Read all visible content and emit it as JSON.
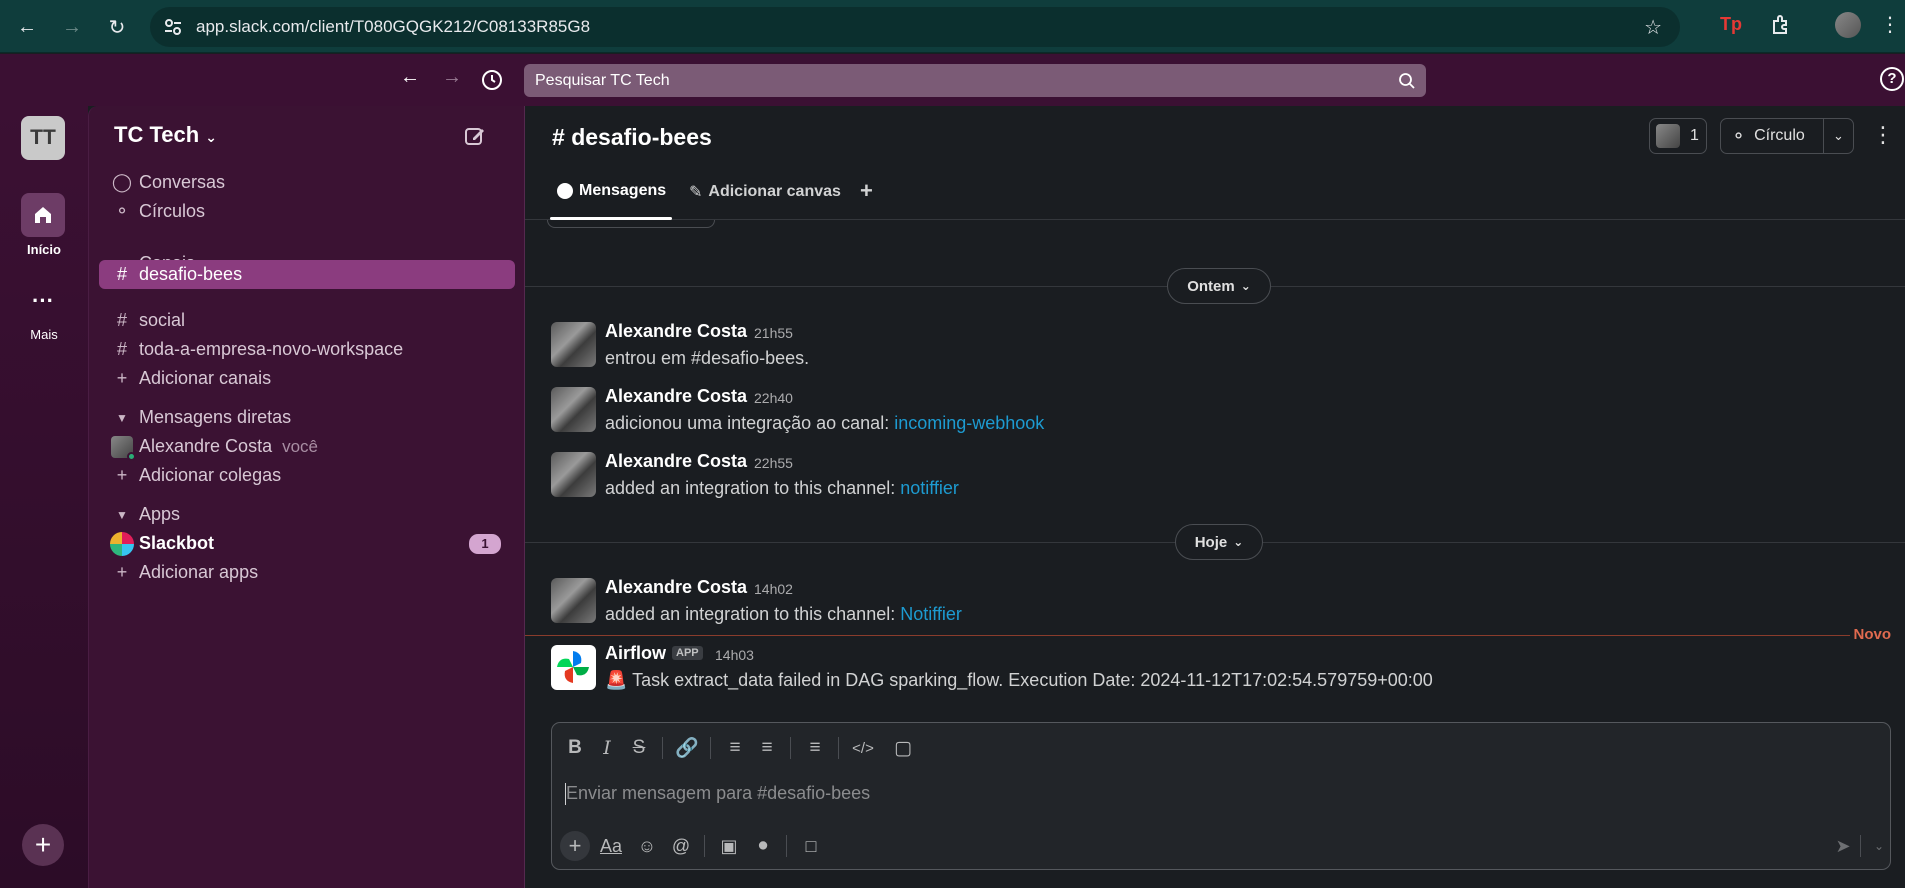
{
  "browser": {
    "url": "app.slack.com/client/T080GQGK212/C08133R85G8"
  },
  "slack_top": {
    "search_placeholder": "Pesquisar TC Tech",
    "help": "?"
  },
  "rail": {
    "workspace_initials": "TT",
    "home_label": "Início",
    "more_label": "Mais"
  },
  "sidebar": {
    "workspace_name": "TC Tech",
    "top_items": [
      {
        "label": "Conversas",
        "icon": "threads-icon"
      },
      {
        "label": "Círculos",
        "icon": "headphones-icon"
      }
    ],
    "channels_header": "Canais",
    "channels": [
      {
        "label": "desafio-bees",
        "active": true
      },
      {
        "label": "social",
        "active": false
      },
      {
        "label": "toda-a-empresa-novo-workspace",
        "active": false
      }
    ],
    "add_channels": "Adicionar canais",
    "dm_header": "Mensagens diretas",
    "dm_user": "Alexandre Costa",
    "dm_you": "você",
    "add_colleagues": "Adicionar colegas",
    "apps_header": "Apps",
    "app_slackbot": "Slackbot",
    "slackbot_badge": "1",
    "add_apps": "Adicionar apps"
  },
  "channel": {
    "title": "desafio-bees",
    "member_count": "1",
    "huddle_label": "Círculo",
    "tabs": [
      {
        "label": "Mensagens",
        "active": true
      },
      {
        "label": "Adicionar canvas",
        "active": false
      }
    ]
  },
  "messages": {
    "day_yesterday": "Ontem",
    "day_today": "Hoje",
    "new_label": "Novo",
    "items": [
      {
        "author": "Alexandre Costa",
        "time": "21h55",
        "text": "entrou em #desafio-bees.",
        "link": ""
      },
      {
        "author": "Alexandre Costa",
        "time": "22h40",
        "text": "adicionou uma integração ao canal: ",
        "link": "incoming-webhook"
      },
      {
        "author": "Alexandre Costa",
        "time": "22h55",
        "text": "added an integration to this channel: ",
        "link": "notiffier"
      },
      {
        "author": "Alexandre Costa",
        "time": "14h02",
        "text": "added an integration to this channel: ",
        "link": "Notiffier"
      }
    ],
    "airflow": {
      "author": "Airflow",
      "tag": "APP",
      "time": "14h03",
      "emoji": "🚨",
      "text": "Task extract_data failed in DAG sparking_flow. Execution Date: 2024-11-12T17:02:54.579759+00:00"
    }
  },
  "composer": {
    "placeholder": "Enviar mensagem para #desafio-bees",
    "format_label": "Aa"
  },
  "colors": {
    "aubergine": "#3b1233",
    "active_channel": "#8b3c7f",
    "link": "#1d9bd1",
    "new_line": "#e06a4f"
  }
}
